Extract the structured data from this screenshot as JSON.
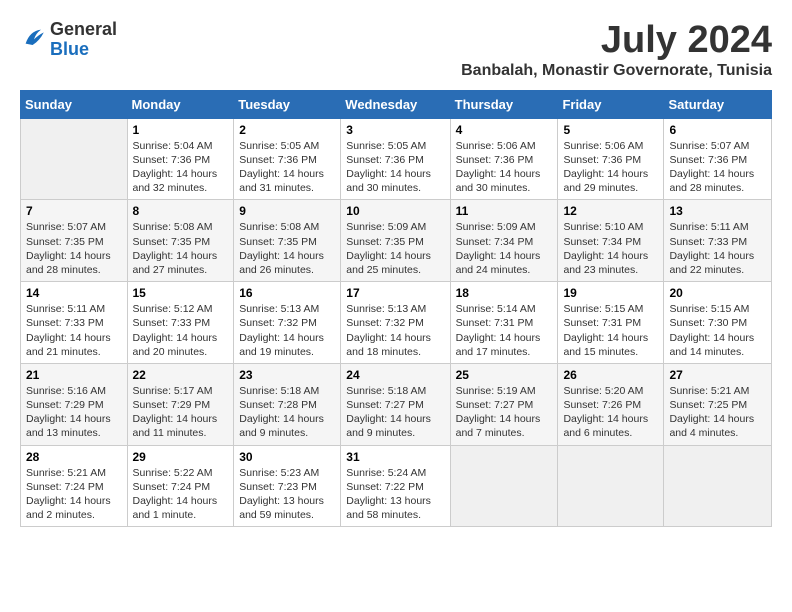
{
  "logo": {
    "general": "General",
    "blue": "Blue"
  },
  "title": "July 2024",
  "subtitle": "Banbalah, Monastir Governorate, Tunisia",
  "headers": [
    "Sunday",
    "Monday",
    "Tuesday",
    "Wednesday",
    "Thursday",
    "Friday",
    "Saturday"
  ],
  "weeks": [
    [
      {
        "day": "",
        "sunrise": "",
        "sunset": "",
        "daylight": ""
      },
      {
        "day": "1",
        "sunrise": "Sunrise: 5:04 AM",
        "sunset": "Sunset: 7:36 PM",
        "daylight": "Daylight: 14 hours and 32 minutes."
      },
      {
        "day": "2",
        "sunrise": "Sunrise: 5:05 AM",
        "sunset": "Sunset: 7:36 PM",
        "daylight": "Daylight: 14 hours and 31 minutes."
      },
      {
        "day": "3",
        "sunrise": "Sunrise: 5:05 AM",
        "sunset": "Sunset: 7:36 PM",
        "daylight": "Daylight: 14 hours and 30 minutes."
      },
      {
        "day": "4",
        "sunrise": "Sunrise: 5:06 AM",
        "sunset": "Sunset: 7:36 PM",
        "daylight": "Daylight: 14 hours and 30 minutes."
      },
      {
        "day": "5",
        "sunrise": "Sunrise: 5:06 AM",
        "sunset": "Sunset: 7:36 PM",
        "daylight": "Daylight: 14 hours and 29 minutes."
      },
      {
        "day": "6",
        "sunrise": "Sunrise: 5:07 AM",
        "sunset": "Sunset: 7:36 PM",
        "daylight": "Daylight: 14 hours and 28 minutes."
      }
    ],
    [
      {
        "day": "7",
        "sunrise": "Sunrise: 5:07 AM",
        "sunset": "Sunset: 7:35 PM",
        "daylight": "Daylight: 14 hours and 28 minutes."
      },
      {
        "day": "8",
        "sunrise": "Sunrise: 5:08 AM",
        "sunset": "Sunset: 7:35 PM",
        "daylight": "Daylight: 14 hours and 27 minutes."
      },
      {
        "day": "9",
        "sunrise": "Sunrise: 5:08 AM",
        "sunset": "Sunset: 7:35 PM",
        "daylight": "Daylight: 14 hours and 26 minutes."
      },
      {
        "day": "10",
        "sunrise": "Sunrise: 5:09 AM",
        "sunset": "Sunset: 7:35 PM",
        "daylight": "Daylight: 14 hours and 25 minutes."
      },
      {
        "day": "11",
        "sunrise": "Sunrise: 5:09 AM",
        "sunset": "Sunset: 7:34 PM",
        "daylight": "Daylight: 14 hours and 24 minutes."
      },
      {
        "day": "12",
        "sunrise": "Sunrise: 5:10 AM",
        "sunset": "Sunset: 7:34 PM",
        "daylight": "Daylight: 14 hours and 23 minutes."
      },
      {
        "day": "13",
        "sunrise": "Sunrise: 5:11 AM",
        "sunset": "Sunset: 7:33 PM",
        "daylight": "Daylight: 14 hours and 22 minutes."
      }
    ],
    [
      {
        "day": "14",
        "sunrise": "Sunrise: 5:11 AM",
        "sunset": "Sunset: 7:33 PM",
        "daylight": "Daylight: 14 hours and 21 minutes."
      },
      {
        "day": "15",
        "sunrise": "Sunrise: 5:12 AM",
        "sunset": "Sunset: 7:33 PM",
        "daylight": "Daylight: 14 hours and 20 minutes."
      },
      {
        "day": "16",
        "sunrise": "Sunrise: 5:13 AM",
        "sunset": "Sunset: 7:32 PM",
        "daylight": "Daylight: 14 hours and 19 minutes."
      },
      {
        "day": "17",
        "sunrise": "Sunrise: 5:13 AM",
        "sunset": "Sunset: 7:32 PM",
        "daylight": "Daylight: 14 hours and 18 minutes."
      },
      {
        "day": "18",
        "sunrise": "Sunrise: 5:14 AM",
        "sunset": "Sunset: 7:31 PM",
        "daylight": "Daylight: 14 hours and 17 minutes."
      },
      {
        "day": "19",
        "sunrise": "Sunrise: 5:15 AM",
        "sunset": "Sunset: 7:31 PM",
        "daylight": "Daylight: 14 hours and 15 minutes."
      },
      {
        "day": "20",
        "sunrise": "Sunrise: 5:15 AM",
        "sunset": "Sunset: 7:30 PM",
        "daylight": "Daylight: 14 hours and 14 minutes."
      }
    ],
    [
      {
        "day": "21",
        "sunrise": "Sunrise: 5:16 AM",
        "sunset": "Sunset: 7:29 PM",
        "daylight": "Daylight: 14 hours and 13 minutes."
      },
      {
        "day": "22",
        "sunrise": "Sunrise: 5:17 AM",
        "sunset": "Sunset: 7:29 PM",
        "daylight": "Daylight: 14 hours and 11 minutes."
      },
      {
        "day": "23",
        "sunrise": "Sunrise: 5:18 AM",
        "sunset": "Sunset: 7:28 PM",
        "daylight": "Daylight: 14 hours and 9 minutes."
      },
      {
        "day": "24",
        "sunrise": "Sunrise: 5:18 AM",
        "sunset": "Sunset: 7:27 PM",
        "daylight": "Daylight: 14 hours and 9 minutes."
      },
      {
        "day": "25",
        "sunrise": "Sunrise: 5:19 AM",
        "sunset": "Sunset: 7:27 PM",
        "daylight": "Daylight: 14 hours and 7 minutes."
      },
      {
        "day": "26",
        "sunrise": "Sunrise: 5:20 AM",
        "sunset": "Sunset: 7:26 PM",
        "daylight": "Daylight: 14 hours and 6 minutes."
      },
      {
        "day": "27",
        "sunrise": "Sunrise: 5:21 AM",
        "sunset": "Sunset: 7:25 PM",
        "daylight": "Daylight: 14 hours and 4 minutes."
      }
    ],
    [
      {
        "day": "28",
        "sunrise": "Sunrise: 5:21 AM",
        "sunset": "Sunset: 7:24 PM",
        "daylight": "Daylight: 14 hours and 2 minutes."
      },
      {
        "day": "29",
        "sunrise": "Sunrise: 5:22 AM",
        "sunset": "Sunset: 7:24 PM",
        "daylight": "Daylight: 14 hours and 1 minute."
      },
      {
        "day": "30",
        "sunrise": "Sunrise: 5:23 AM",
        "sunset": "Sunset: 7:23 PM",
        "daylight": "Daylight: 13 hours and 59 minutes."
      },
      {
        "day": "31",
        "sunrise": "Sunrise: 5:24 AM",
        "sunset": "Sunset: 7:22 PM",
        "daylight": "Daylight: 13 hours and 58 minutes."
      },
      {
        "day": "",
        "sunrise": "",
        "sunset": "",
        "daylight": ""
      },
      {
        "day": "",
        "sunrise": "",
        "sunset": "",
        "daylight": ""
      },
      {
        "day": "",
        "sunrise": "",
        "sunset": "",
        "daylight": ""
      }
    ]
  ]
}
